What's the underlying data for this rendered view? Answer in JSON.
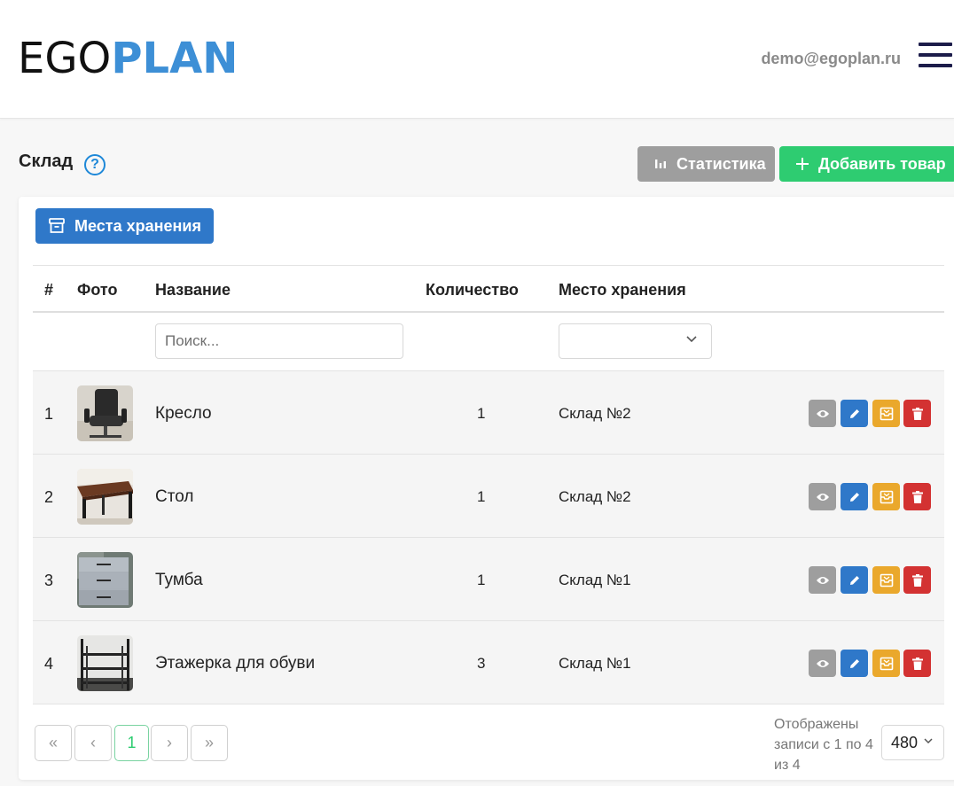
{
  "header": {
    "logo_part1": "EGO",
    "logo_part2": "PLAN",
    "user_email": "demo@egoplan.ru",
    "menu_icon": "hamburger-icon"
  },
  "page": {
    "title": "Склад",
    "help_glyph": "?",
    "stats_button": "Статистика",
    "add_button": "Добавить товар",
    "storage_button": "Места хранения"
  },
  "table": {
    "columns": [
      "#",
      "Фото",
      "Название",
      "Количество",
      "Место хранения"
    ],
    "search_placeholder": "Поиск...",
    "location_filter_value": "",
    "rows": [
      {
        "num": "1",
        "photo": "chair-photo",
        "name": "Кресло",
        "qty": "1",
        "place": "Склад №2"
      },
      {
        "num": "2",
        "photo": "table-photo",
        "name": "Стол",
        "qty": "1",
        "place": "Склад №2"
      },
      {
        "num": "3",
        "photo": "cabinet-photo",
        "name": "Тумба",
        "qty": "1",
        "place": "Склад №1"
      },
      {
        "num": "4",
        "photo": "shoe-rack-photo",
        "name": "Этажерка для обуви",
        "qty": "3",
        "place": "Склад №1"
      }
    ],
    "row_actions": [
      "view-icon",
      "edit-icon",
      "move-icon",
      "delete-icon"
    ]
  },
  "pagination": {
    "first": "«",
    "prev": "‹",
    "current_page": "1",
    "next": "›",
    "last": "»",
    "records_info": "Отображены записи с 1 по 4 из 4",
    "per_page": "480"
  },
  "colors": {
    "accent_blue": "#2f78c9",
    "success_green": "#2ecc71",
    "neutral_gray": "#9e9e9e",
    "warning_orange": "#eaa82c",
    "danger_red": "#d33232",
    "logo_blue": "#3d8fd6"
  }
}
